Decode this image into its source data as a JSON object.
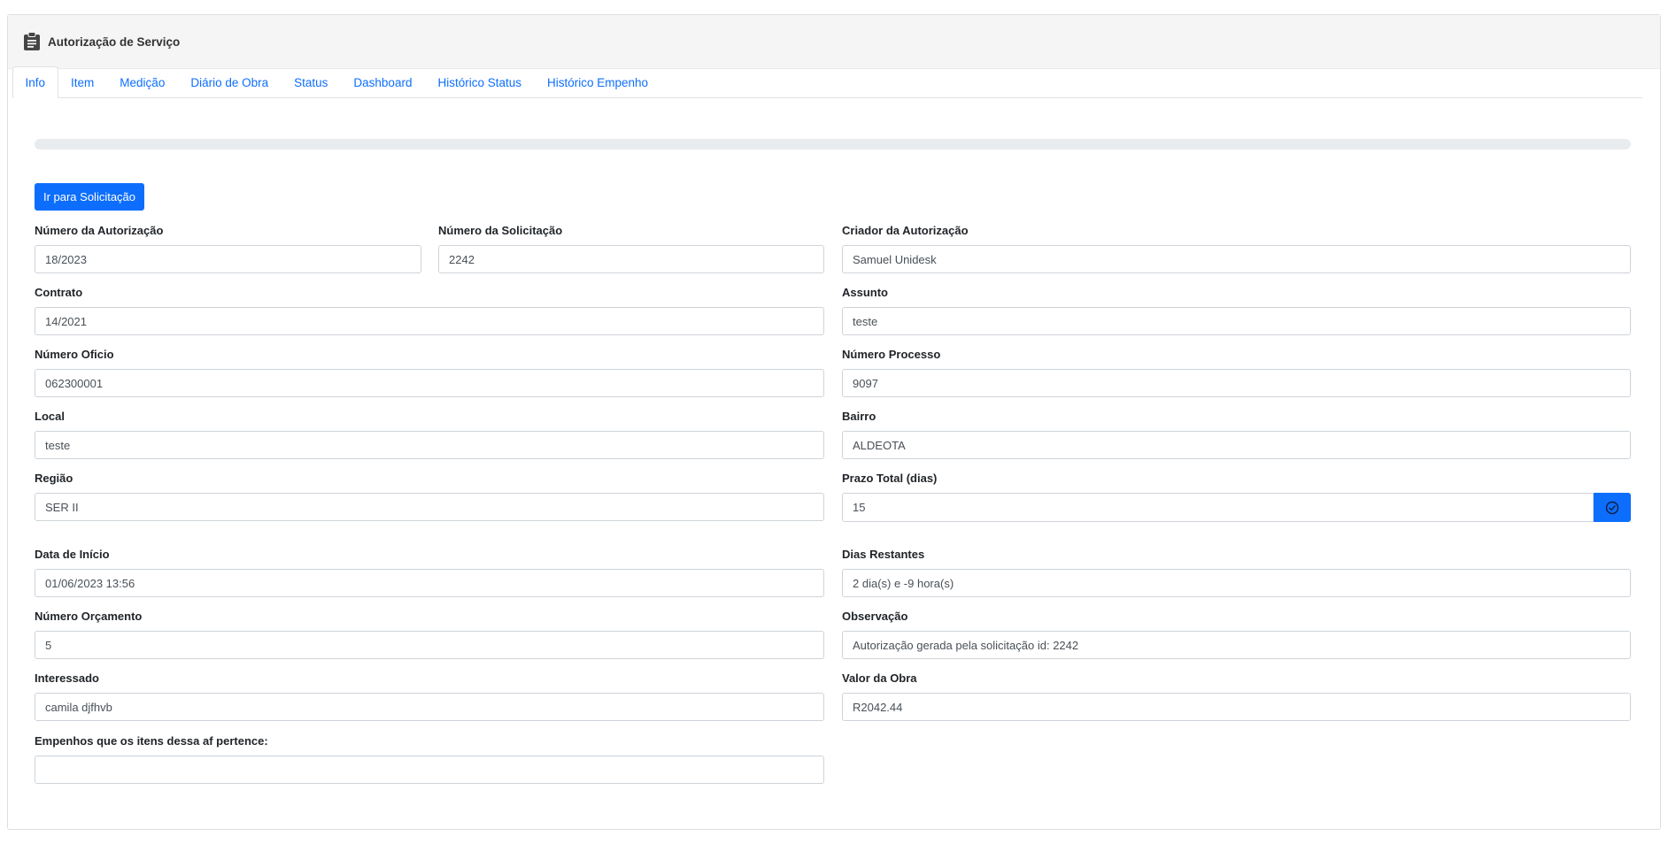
{
  "header": {
    "title": "Autorização de Serviço",
    "icon": "clipboard-icon"
  },
  "tabs": [
    {
      "label": "Info",
      "active": true
    },
    {
      "label": "Item"
    },
    {
      "label": "Medição"
    },
    {
      "label": "Diário de Obra"
    },
    {
      "label": "Status"
    },
    {
      "label": "Dashboard"
    },
    {
      "label": "Histórico Status"
    },
    {
      "label": "Histórico Empenho"
    }
  ],
  "progress": {
    "value": 0
  },
  "actions": {
    "go_to_request": "Ir para Solicitação"
  },
  "fields": {
    "numero_autorizacao": {
      "label": "Número da Autorização",
      "value": "18/2023"
    },
    "numero_solicitacao": {
      "label": "Número da Solicitação",
      "value": "2242"
    },
    "criador": {
      "label": "Criador da Autorização",
      "value": "Samuel Unidesk"
    },
    "contrato": {
      "label": "Contrato",
      "value": "14/2021"
    },
    "assunto": {
      "label": "Assunto",
      "value": "teste"
    },
    "numero_oficio": {
      "label": "Número Oficio",
      "value": "062300001"
    },
    "numero_processo": {
      "label": "Número Processo",
      "value": "9097"
    },
    "local": {
      "label": "Local",
      "value": "teste"
    },
    "bairro": {
      "label": "Bairro",
      "value": "ALDEOTA"
    },
    "regiao": {
      "label": "Região",
      "value": "SER II"
    },
    "prazo_total": {
      "label": "Prazo Total (dias)",
      "value": "15"
    },
    "data_inicio": {
      "label": "Data de Início",
      "value": "01/06/2023 13:56"
    },
    "dias_restantes": {
      "label": "Dias Restantes",
      "value": "2 dia(s) e -9 hora(s)"
    },
    "numero_orcamento": {
      "label": "Número Orçamento",
      "value": "5"
    },
    "observacao": {
      "label": "Observação",
      "value": "Autorização gerada pela solicitação id: 2242"
    },
    "interessado": {
      "label": "Interessado",
      "value": "camila djfhvb"
    },
    "valor_obra": {
      "label": "Valor da Obra",
      "value": "R2042.44"
    },
    "empenhos": {
      "label": "Empenhos que os itens dessa af pertence:",
      "value": ""
    }
  },
  "colors": {
    "primary": "#0d6efd",
    "header_bg": "#f5f5f5",
    "border": "#ced4da"
  }
}
